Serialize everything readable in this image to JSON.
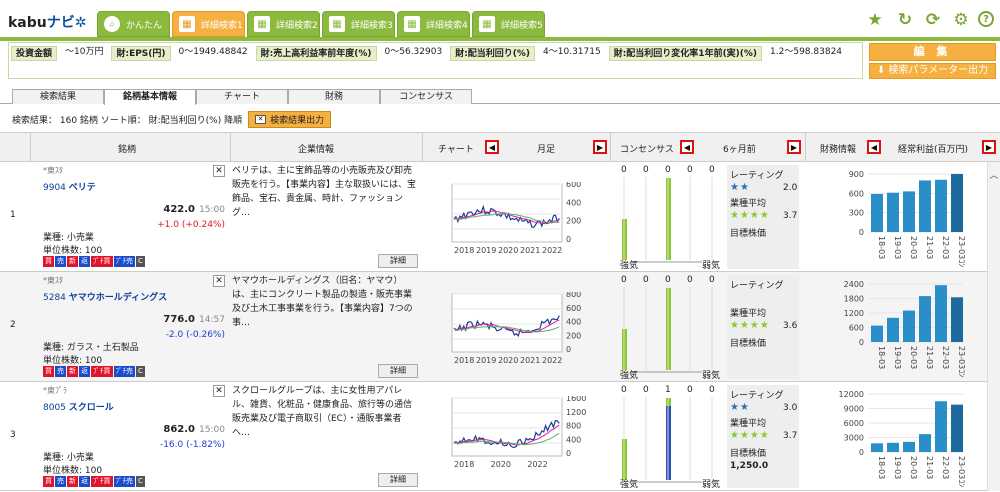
{
  "app": {
    "logo_text": "kabu",
    "logo_navi": "ナビ"
  },
  "tabs": [
    {
      "label": "かんたん",
      "icon": "search-icon"
    },
    {
      "label": "詳細検索1",
      "icon": "calendar-icon",
      "active": true
    },
    {
      "label": "詳細検索2",
      "icon": "calendar-icon"
    },
    {
      "label": "詳細検索3",
      "icon": "calendar-icon"
    },
    {
      "label": "詳細検索4",
      "icon": "calendar-icon"
    },
    {
      "label": "詳細検索5",
      "icon": "calendar-icon"
    }
  ],
  "top_icons": [
    "star-icon",
    "reload-icon",
    "refresh-icon",
    "gear-icon",
    "help-icon"
  ],
  "params": [
    {
      "label": "投資金額",
      "value": "〜10万円"
    },
    {
      "label": "財:EPS(円)",
      "value": "0〜1949.48842"
    },
    {
      "label": "財:売上高利益率前年度(%)",
      "value": "0〜56.32903"
    },
    {
      "label": "財:配当利回り(%)",
      "value": "4〜10.31715"
    },
    {
      "label": "財:配当利回り変化率1年前(実)(%)",
      "value": "1.2〜598.83824"
    }
  ],
  "buttons": {
    "edit": "編 集",
    "export_params": "検索パラメーター出力",
    "export_results": "検索結果出力"
  },
  "subtabs": [
    "検索結果",
    "銘柄基本情報",
    "チャート",
    "財務",
    "コンセンサス"
  ],
  "result_summary": "検索結果： 160 銘柄  ソート順： 財:配当利回り(%) 降順",
  "headers": {
    "stock": "銘柄",
    "company": "企業情報",
    "chart": "チャート",
    "chart_period": "月足",
    "consensus": "コンセンサス",
    "consensus_period": "6ヶ月前",
    "financial": "財務情報",
    "financial_metric": "経常利益(百万円)"
  },
  "colors": {
    "accent_green": "#8cba3f",
    "accent_orange": "#f6b040",
    "bar_blue": "#2a8ec9",
    "bar_dark": "#1e6a9f",
    "up_red": "#e0152a",
    "down_blue": "#1a3ccc"
  },
  "rows": [
    {
      "num": "1",
      "market": "*東ｽﾀ",
      "code": "9904",
      "name": "ベリテ",
      "price": "422.0",
      "time": "15:00",
      "change": "+1.0",
      "change_pct": "(+0.24%)",
      "direction": "up",
      "industry": "業種: 小売業",
      "unit": "単位株数: 100",
      "badges": [
        "買",
        "売",
        "新",
        "返",
        "ﾌﾟﾁ買",
        "ﾌﾟﾁ売",
        "C"
      ],
      "desc": "ベリテは、主に宝飾品等の小売販売及び卸売販売を行う。【事業内容】主な取扱いには、宝飾品、宝石、貴金属、時計、ファッショング…",
      "detail": "詳細",
      "chart_years": [
        "2018",
        "2019",
        "2020",
        "2021",
        "2022"
      ],
      "chart_yticks": [
        "600",
        "400",
        "200",
        "0"
      ],
      "consensus_values": [
        "0",
        "0",
        "0",
        "0",
        "0"
      ],
      "consensus_bars": [
        0.5,
        0,
        1,
        0,
        0
      ],
      "weak": "強気",
      "strong": "弱気",
      "rating": {
        "label": "レーティング",
        "stars1": 2,
        "val1": "2.0",
        "avg_label": "業種平均",
        "stars2": 4,
        "val2": "3.7",
        "target": "目標株価",
        "target_val": ""
      },
      "fin_yticks": [
        "900",
        "600",
        "300",
        "0"
      ],
      "fin_cats": [
        "18-03",
        "19-03",
        "20-03",
        "21-03",
        "22-03",
        "23-03ｺﾝ"
      ],
      "fin_values": [
        590,
        610,
        630,
        800,
        810,
        900
      ]
    },
    {
      "num": "2",
      "market": "*東ｽﾀ",
      "code": "5284",
      "name": "ヤマウホールディングス",
      "price": "776.0",
      "time": "14:57",
      "change": "-2.0",
      "change_pct": "(-0.26%)",
      "direction": "down",
      "industry": "業種: ガラス・土石製品",
      "unit": "単位株数: 100",
      "badges": [
        "買",
        "売",
        "新",
        "返",
        "ﾌﾟﾁ買",
        "ﾌﾟﾁ売",
        "C"
      ],
      "desc": "ヤマウホールディングス（旧名：ヤマウ）は、主にコンクリート製品の製造・販売事業及び土木工事事業を行う。【事業内容】7つの事…",
      "detail": "詳細",
      "chart_years": [
        "2018",
        "2019",
        "2020",
        "2021",
        "2022"
      ],
      "chart_yticks": [
        "800",
        "600",
        "400",
        "200",
        "0"
      ],
      "consensus_values": [
        "0",
        "0",
        "0",
        "0",
        "0"
      ],
      "consensus_bars": [
        0.5,
        0,
        1,
        0,
        0
      ],
      "weak": "強気",
      "strong": "弱気",
      "rating": {
        "label": "レーティング",
        "stars1": 0,
        "val1": "",
        "avg_label": "業種平均",
        "stars2": 4,
        "val2": "3.6",
        "target": "目標株価",
        "target_val": ""
      },
      "fin_yticks": [
        "2400",
        "1800",
        "1200",
        "600",
        "0"
      ],
      "fin_cats": [
        "18-03",
        "19-03",
        "20-03",
        "21-03",
        "22-03",
        "23-03ｺﾝ"
      ],
      "fin_values": [
        680,
        1000,
        1300,
        1900,
        2350,
        1850
      ]
    },
    {
      "num": "3",
      "market": "*東ﾌﾟﾗ",
      "code": "8005",
      "name": "スクロール",
      "price": "862.0",
      "time": "15:00",
      "change": "-16.0",
      "change_pct": "(-1.82%)",
      "direction": "down",
      "industry": "業種: 小売業",
      "unit": "単位株数: 100",
      "badges": [
        "買",
        "売",
        "新",
        "返",
        "ﾌﾟﾁ買",
        "ﾌﾟﾁ売",
        "C"
      ],
      "desc": "スクロールグループは、主に女性用アパレル、雑貨、化粧品・健康食品、旅行等の通信販売業及び電子商取引（EC）・通販事業者へ…",
      "detail": "詳細",
      "chart_years": [
        "2018",
        "2020",
        "2022"
      ],
      "chart_yticks": [
        "1600",
        "1200",
        "800",
        "400",
        "0"
      ],
      "consensus_values": [
        "0",
        "0",
        "1",
        "0",
        "0"
      ],
      "consensus_bars": [
        0.5,
        0,
        1,
        0,
        0
      ],
      "weak": "強気",
      "strong": "弱気",
      "rating": {
        "label": "レーティング",
        "stars1": 2,
        "val1": "3.0",
        "avg_label": "業種平均",
        "stars2": 4,
        "val2": "3.7",
        "target": "目標株価",
        "target_val": "1,250.0"
      },
      "fin_yticks": [
        "12000",
        "9000",
        "6000",
        "3000",
        "0"
      ],
      "fin_cats": [
        "18-03",
        "19-03",
        "20-03",
        "21-03",
        "22-03",
        "23-03ｺﾝ"
      ],
      "fin_values": [
        1800,
        1900,
        2100,
        3700,
        10500,
        9800
      ]
    }
  ]
}
